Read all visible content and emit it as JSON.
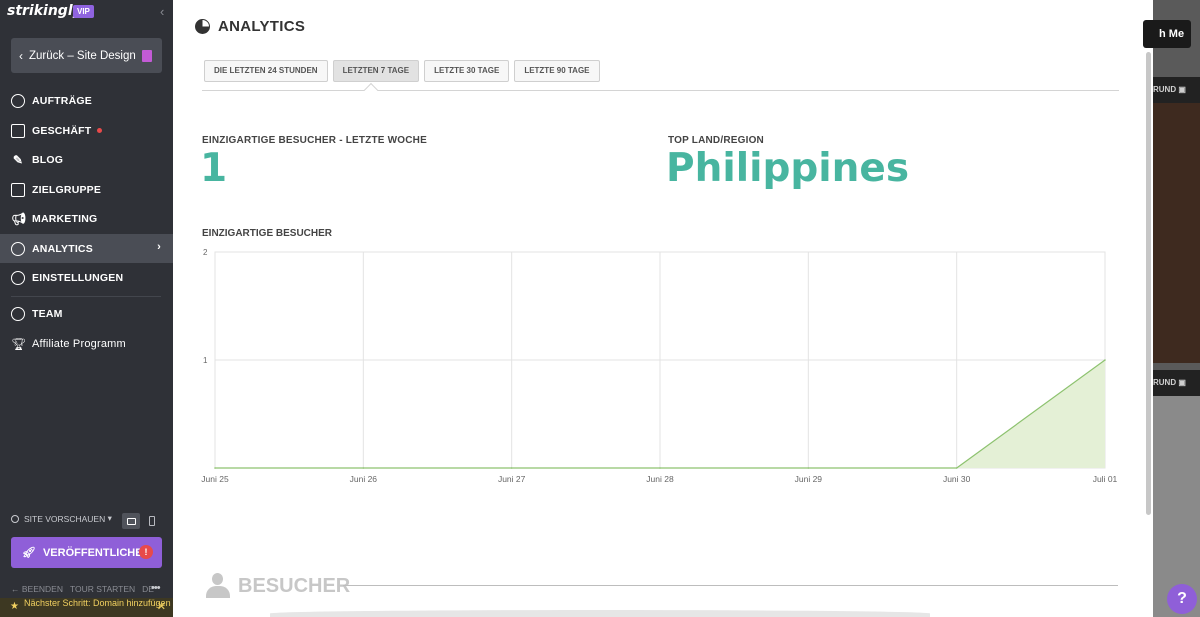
{
  "sidebar": {
    "logo": "strikingly",
    "vip_badge": "VIP",
    "back_button": "Zurück – Site Design",
    "items": [
      {
        "label": "AUFTRÄGE",
        "icon": "dollar-icon"
      },
      {
        "label": "GESCHÄFT",
        "icon": "store-icon",
        "notification_dot": true
      },
      {
        "label": "BLOG",
        "icon": "pen-icon"
      },
      {
        "label": "ZIELGRUPPE",
        "icon": "audience-icon"
      },
      {
        "label": "MARKETING",
        "icon": "megaphone-icon"
      },
      {
        "label": "ANALYTICS",
        "icon": "pie-chart-icon",
        "active": true
      },
      {
        "label": "EINSTELLUNGEN",
        "icon": "gear-icon"
      },
      {
        "label": "TEAM",
        "icon": "team-icon"
      },
      {
        "label": "Affiliate Programm",
        "icon": "trophy-icon"
      }
    ],
    "preview_label": "SITE VORSCHAUEN",
    "publish_button": "VERÖFFENTLICHEN",
    "publish_warning": "!",
    "footer": {
      "exit": "BEENDEN",
      "tour": "TOUR STARTEN",
      "lang": "DE"
    },
    "next_step": "Nächster Schritt: Domain hinzufügen"
  },
  "editor": {
    "top_button": "h Me",
    "strip_label": "RUND"
  },
  "main": {
    "title": "ANALYTICS",
    "tabs": [
      {
        "label": "DIE LETZTEN 24 STUNDEN"
      },
      {
        "label": "LETZTEN 7 TAGE",
        "active": true
      },
      {
        "label": "LETZTE 30 TAGE"
      },
      {
        "label": "LETZTE 90 TAGE"
      }
    ],
    "unique_visitors_label": "EINZIGARTIGE BESUCHER - LETZTE WOCHE",
    "unique_visitors_value": "1",
    "top_region_label": "TOP LAND/REGION",
    "top_region_value": "Philippines",
    "chart_title": "EINZIGARTIGE BESUCHER",
    "section_title": "BESUCHER"
  },
  "chart_data": {
    "type": "area",
    "categories": [
      "Juni 25",
      "Juni 26",
      "Juni 27",
      "Juni 28",
      "Juni 29",
      "Juni 30",
      "Juli 01"
    ],
    "series": [
      {
        "values": [
          0,
          0,
          0,
          0,
          0,
          0,
          1
        ]
      }
    ],
    "ylim": [
      0,
      2
    ],
    "yticks": [
      1,
      2
    ],
    "grid": true,
    "colors": {
      "line": "#8dc26f",
      "fill": "#e4f0d6"
    }
  },
  "help": "?"
}
